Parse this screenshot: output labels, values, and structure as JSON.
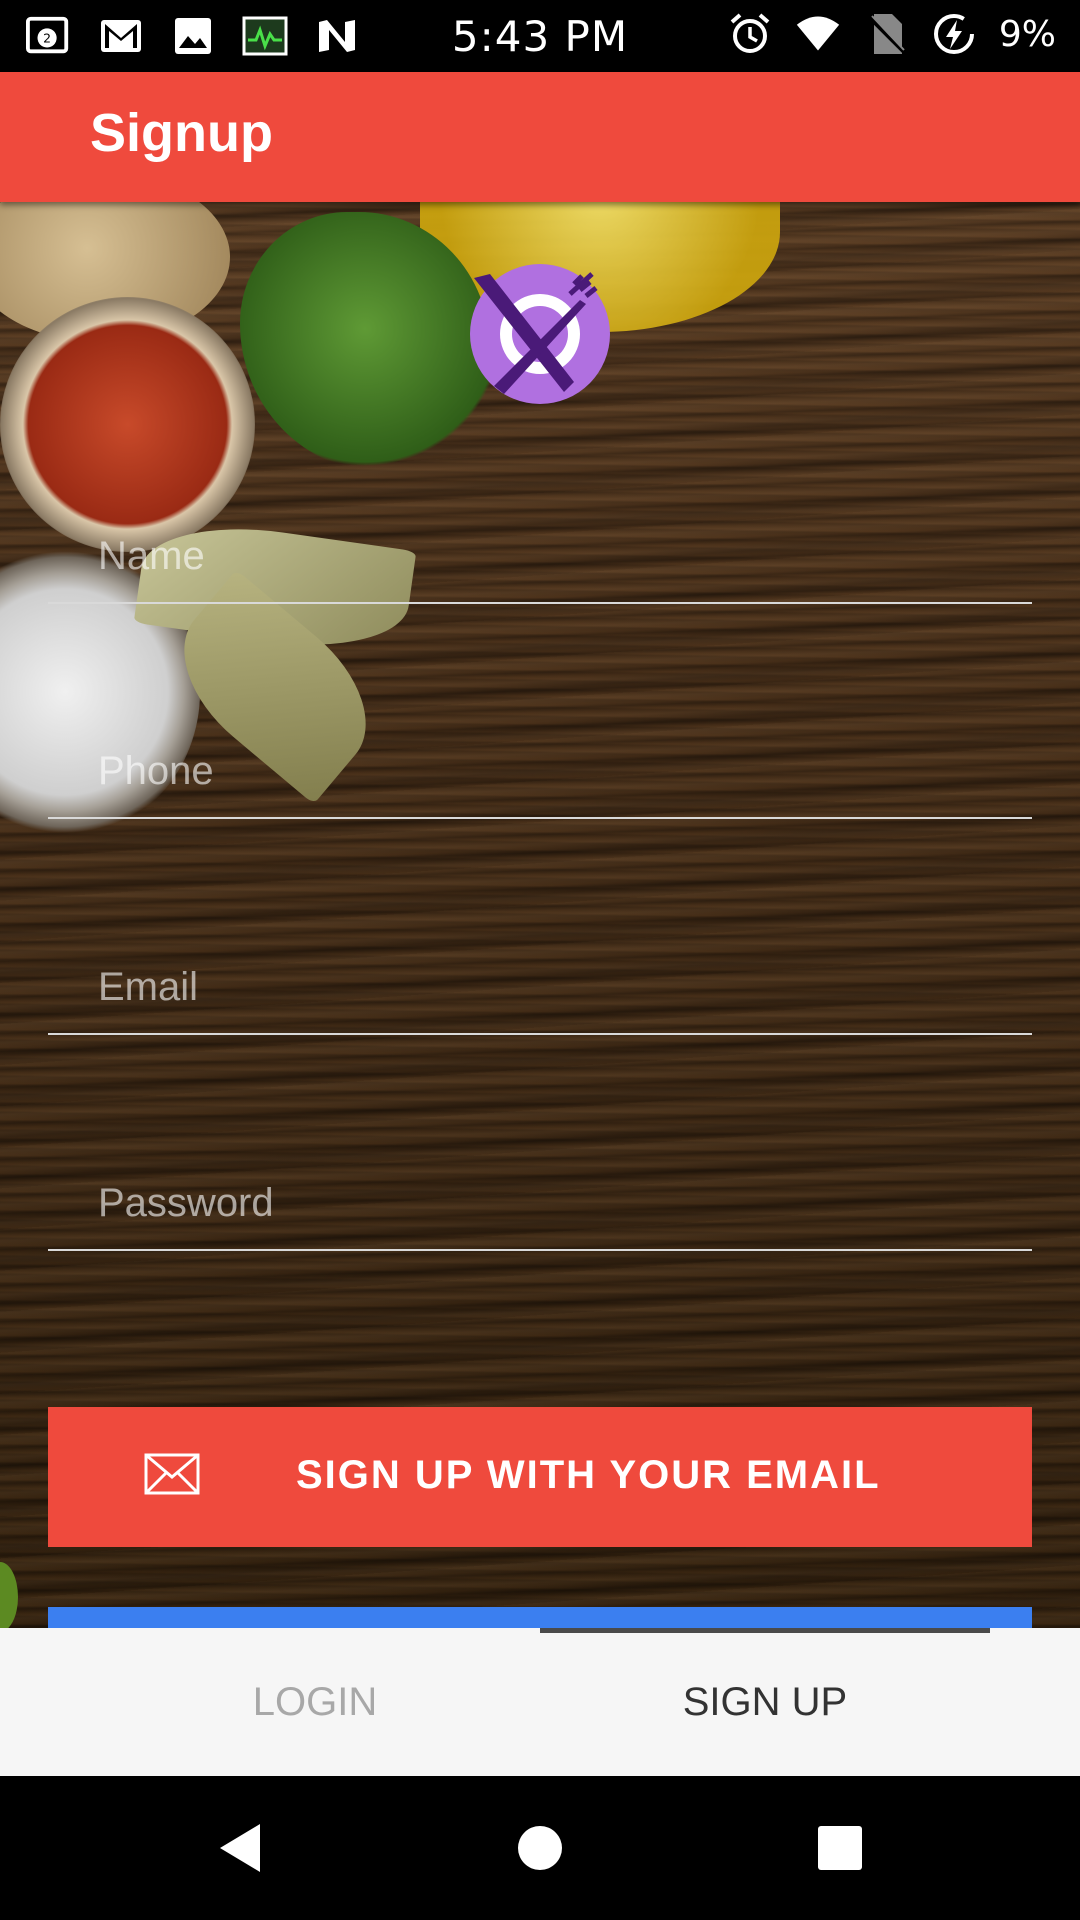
{
  "status_bar": {
    "time": "5:43 PM",
    "battery": "9%",
    "notification_count": "2",
    "left_icons": [
      "gallery-notification-icon",
      "gmail-icon",
      "image-icon",
      "activity-monitor-icon",
      "n-app-icon"
    ],
    "right_icons": [
      "alarm-icon",
      "wifi-icon",
      "no-sim-icon",
      "battery-charging-icon"
    ]
  },
  "app_bar": {
    "title": "Signup",
    "color": "#ef4a3d"
  },
  "form": {
    "name_placeholder": "Name",
    "phone_placeholder": "Phone",
    "email_placeholder": "Email",
    "password_placeholder": "Password",
    "email_button_label": "SIGN UP WITH YOUR EMAIL",
    "email_button_icon": "envelope-icon",
    "logo_icon": "plate-fork-knife-icon",
    "logo_color": "#b070e0"
  },
  "tabs": {
    "login_label": "LOGIN",
    "signup_label": "SIGN UP",
    "selected": "SIGN UP"
  },
  "nav_bar": {
    "icons": [
      "back-icon",
      "home-icon",
      "recents-icon"
    ]
  }
}
